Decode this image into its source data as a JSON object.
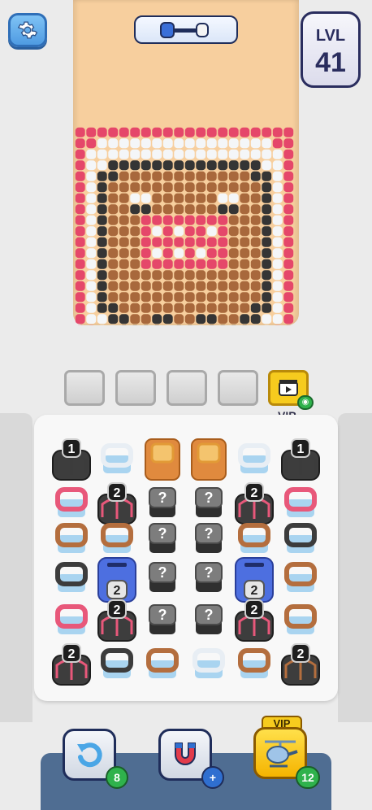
{
  "hud": {
    "level_label": "LVL",
    "level_number": "41",
    "progress_fraction": 0.15
  },
  "boost_slots": {
    "empty_slot_count": 4,
    "vip_label": "VIP",
    "vip_icon": "video-ad-icon"
  },
  "colors": {
    "pink": "#e5476a",
    "white": "#f4f6f8",
    "brown": "#a8683c",
    "black": "#353535",
    "empty": "#f7cf9e",
    "grey": "#8a8a8a"
  },
  "pixel_art": [
    "PPPPPPPPPPPPPPPPPPPP",
    "PPWWWWWWWWWWWWWWWWPP",
    "PWWWWWWWWWWWWWWWWWWP",
    "PWWKKKKKKKKKKKKKKWWP",
    "PWKKBBBBBBBBBBBBKKWP",
    "PWKBBBBBBBBBBBBBBKWP",
    "PWKBBWWBBBBBBWWBBKWP",
    "PWKBBKKBBBBBBKKBBKWP",
    "PWKBBBPPPPPPPPBBBKWP",
    "PWKBBBPWPWPPWPBBBKWP",
    "PWKBBBPPPPPPPPBBBKWP",
    "PWKBBBPWPWPWPPBBBKWP",
    "PWKBBBPPPPPPPPBBBKWP",
    "PWKBBBBBBBBBBBBBBKWP",
    "PWKBBBBBBBBBBBBBBKWP",
    "PWKBBBBBBBBBBBBBBKWP",
    "PWKKBBBBBBBBBBBBKKWP",
    "PWWKKBBKKBBKKBBKKWWP",
    "PPWWKKKKWKKWKKKKWWPP"
  ],
  "grid": {
    "rows": [
      [
        {
          "t": "stack",
          "c": "black",
          "n": "1"
        },
        {
          "t": "ring",
          "c": "white"
        },
        {
          "t": "block",
          "c": "orange"
        },
        {
          "t": "block",
          "c": "orange"
        },
        {
          "t": "ring",
          "c": "white"
        },
        {
          "t": "stack",
          "c": "black",
          "n": "1"
        }
      ],
      [
        {
          "t": "ring",
          "c": "pink"
        },
        {
          "t": "stack",
          "c": "pink",
          "n": "2"
        },
        {
          "t": "mystery"
        },
        {
          "t": "mystery"
        },
        {
          "t": "stack",
          "c": "pink",
          "n": "2"
        },
        {
          "t": "ring",
          "c": "pink"
        }
      ],
      [
        {
          "t": "ring",
          "c": "brown"
        },
        {
          "t": "ring",
          "c": "brown"
        },
        {
          "t": "mystery"
        },
        {
          "t": "mystery"
        },
        {
          "t": "ring",
          "c": "brown"
        },
        {
          "t": "ring",
          "c": "black"
        }
      ],
      [
        {
          "t": "ring",
          "c": "black"
        },
        {
          "t": "tunnel",
          "n": "2"
        },
        {
          "t": "mystery"
        },
        {
          "t": "mystery"
        },
        {
          "t": "tunnel",
          "n": "2"
        },
        {
          "t": "ring",
          "c": "brown"
        }
      ],
      [
        {
          "t": "ring",
          "c": "pink"
        },
        {
          "t": "stack",
          "c": "pink",
          "n": "2"
        },
        {
          "t": "mystery"
        },
        {
          "t": "mystery"
        },
        {
          "t": "stack",
          "c": "pink",
          "n": "2"
        },
        {
          "t": "ring",
          "c": "brown"
        }
      ],
      [
        {
          "t": "stack",
          "c": "pink",
          "n": "2"
        },
        {
          "t": "ring",
          "c": "black"
        },
        {
          "t": "ring",
          "c": "brown"
        },
        {
          "t": "ring",
          "c": "white"
        },
        {
          "t": "ring",
          "c": "brown"
        },
        {
          "t": "stack",
          "c": "brown",
          "n": "2"
        }
      ]
    ],
    "mystery_mark": "?"
  },
  "tools": {
    "undo_count": "8",
    "magnet_add": "+",
    "helicopter_count": "12",
    "vip_label": "VIP"
  }
}
